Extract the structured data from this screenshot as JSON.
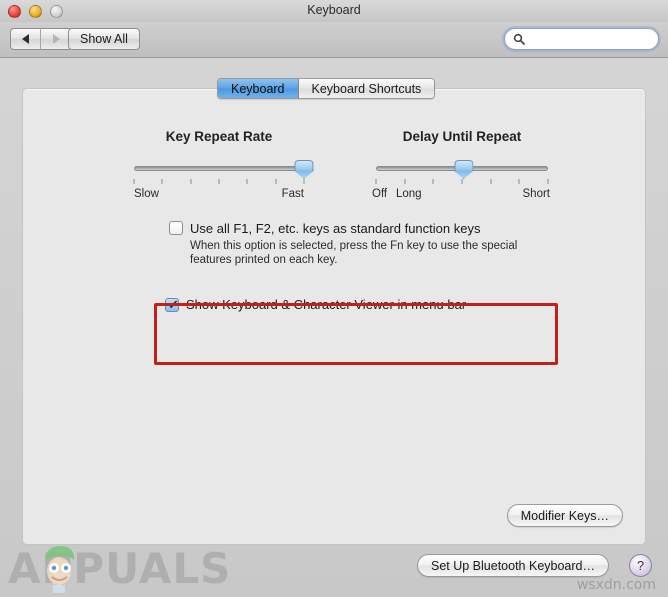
{
  "window": {
    "title": "Keyboard",
    "traffic_lights": [
      "close",
      "minimize",
      "zoom"
    ]
  },
  "toolbar": {
    "back_label": "◀",
    "forward_label": "▶",
    "show_all_label": "Show All",
    "search": {
      "value": "",
      "placeholder": "",
      "icon": "search-icon"
    }
  },
  "tabs": [
    {
      "label": "Keyboard",
      "active": true
    },
    {
      "label": "Keyboard Shortcuts",
      "active": false
    }
  ],
  "sliders": {
    "key_repeat_rate": {
      "title": "Key Repeat Rate",
      "left_label": "Slow",
      "right_label": "Fast",
      "ticks": 7,
      "value_index": 7,
      "thumb_percent": 100
    },
    "delay_until_repeat": {
      "title": "Delay Until Repeat",
      "off_label": "Off",
      "long_label": "Long",
      "short_label": "Short",
      "ticks": 7,
      "value_index": 4,
      "thumb_percent": 51
    }
  },
  "options": {
    "fn_keys": {
      "label": "Use all F1, F2, etc. keys as standard function keys",
      "description": "When this option is selected, press the Fn key to use the special features printed on each key.",
      "checked": false,
      "check_glyph": ""
    },
    "keyboard_viewer": {
      "label": "Show Keyboard & Character Viewer in menu bar",
      "checked": true,
      "check_glyph": "✔"
    }
  },
  "buttons": {
    "modifier_keys": "Modifier Keys…",
    "bluetooth_keyboard": "Set Up Bluetooth Keyboard…",
    "help": "?"
  },
  "annotation": {
    "color": "#c1201b",
    "target": "fn-keys-option"
  },
  "watermarks": {
    "appuals": "APPUALS",
    "wsxdn": "wsxdn.com"
  }
}
